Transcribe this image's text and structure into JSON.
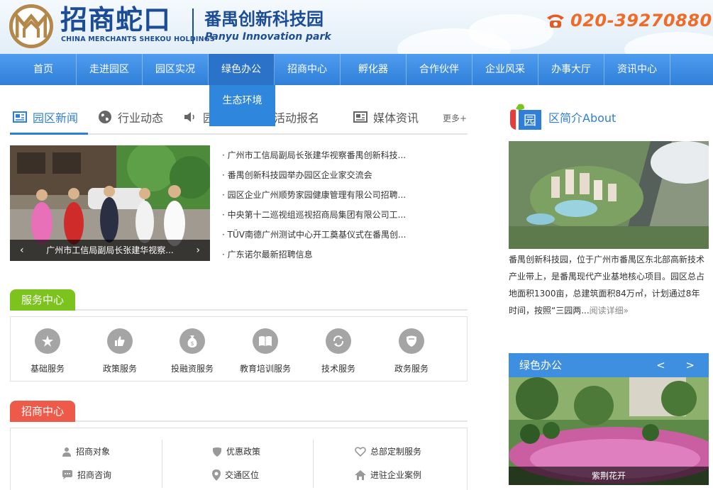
{
  "header": {
    "logo_cn": "招商蛇口",
    "logo_en": "CHINA MERCHANTS SHEKOU HOLDINGS",
    "park_cn": "番禺创新科技园",
    "park_en": "Panyu Innovation park",
    "phone": "020-39270880"
  },
  "nav": {
    "items": [
      "首页",
      "走进园区",
      "园区实况",
      "绿色办公",
      "招商中心",
      "孵化器",
      "合作伙伴",
      "企业风采",
      "办事大厅",
      "资讯中心"
    ],
    "dropdown": "生态环境"
  },
  "news": {
    "tabs": [
      "园区新闻",
      "行业动态",
      "园",
      "活动报名",
      "媒体资讯"
    ],
    "more": "更多+",
    "slide_caption": "广州市工信局副局长张建华视察...",
    "slide_prev": "‹",
    "slide_next": "›",
    "items": [
      "· 广州市工信局副局长张建华视察番禺创新科技...",
      "· 番禺创新科技园举办园区企业家交流会",
      "· 园区企业广州顺势家园健康管理有限公司招聘...",
      "· 中央第十二巡视组巡视招商局集团有限公司工...",
      "· TÜV南德广州测试中心开工奠基仪式在番禺创...",
      "· 广东诺尔最新招聘信息"
    ]
  },
  "service": {
    "title": "服务中心",
    "items": [
      "基础服务",
      "政策服务",
      "投融资服务",
      "教育培训服务",
      "技术服务",
      "政务服务"
    ]
  },
  "investment": {
    "title": "招商中心",
    "items": [
      "招商对象",
      "招商咨询",
      "优惠政策",
      "交通区位",
      "总部定制服务",
      "进驻企业案例"
    ]
  },
  "about": {
    "title": "区简介About",
    "logo_char": "园",
    "text": "番禺创新科技园，位于广州市番禺区东北部高新技术产业带上，是番禺现代产业基地核心项目。园区总占地面积1300亩，总建筑面积84万㎡，计划通过8年时间，按照“三园两...",
    "read_more": "阅读详细»"
  },
  "green": {
    "title": "绿色办公",
    "arrows": "< >",
    "caption": "紫荆花开"
  },
  "colors": {
    "nav_blue": "#2f7fd8",
    "service_green": "#7cc31e",
    "invest_red": "#ee5a4a",
    "phone_orange": "#f06a28",
    "brand_navy": "#1d4c97"
  }
}
